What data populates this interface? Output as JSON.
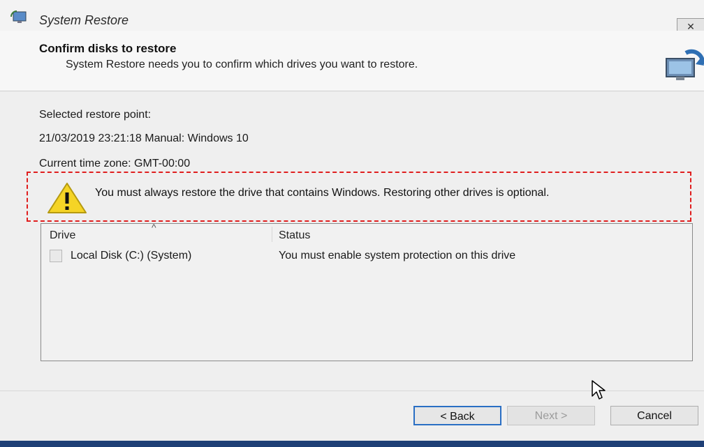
{
  "window": {
    "title": "System Restore",
    "close_symbol": "✕"
  },
  "header": {
    "title": "Confirm disks to restore",
    "subtitle": "System Restore needs you to confirm which drives you want to restore."
  },
  "info": {
    "selected_point_label": "Selected restore point:",
    "selected_point_value": "21/03/2019 23:21:18 Manual: Windows 10",
    "time_zone": "Current time zone: GMT-00:00"
  },
  "warning": {
    "icon": "warning-icon",
    "text": "You must always restore the drive that contains Windows. Restoring other drives is optional."
  },
  "table": {
    "columns": [
      "Drive",
      "Status"
    ],
    "sort_indicator": "^",
    "rows": [
      {
        "drive": "Local Disk (C:) (System)",
        "status": "You must enable system protection on this drive",
        "checked": false
      }
    ]
  },
  "buttons": {
    "back": "< Back",
    "next": "Next >",
    "cancel": "Cancel"
  },
  "colors": {
    "highlight_border": "#e01e1e",
    "focus_border": "#2a6fc4",
    "warning_yellow": "#f5d426"
  }
}
